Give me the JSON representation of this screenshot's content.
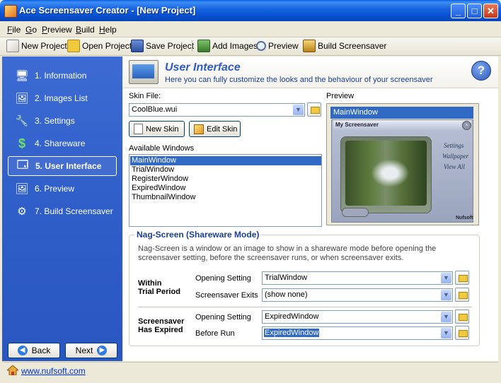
{
  "window": {
    "title": "Ace Screensaver Creator - [New Project]"
  },
  "menu": [
    "File",
    "Go",
    "Preview",
    "Build",
    "Help"
  ],
  "toolbar": {
    "new_project": "New Project",
    "open_project": "Open Project",
    "save_project": "Save Project",
    "add_images": "Add Images",
    "preview": "Preview",
    "build_screensaver": "Build Screensaver"
  },
  "sidebar": {
    "items": [
      {
        "label": "1. Information",
        "icon": "info-icon"
      },
      {
        "label": "2. Images List",
        "icon": "images-icon"
      },
      {
        "label": "3. Settings",
        "icon": "tools-icon"
      },
      {
        "label": "4. Shareware",
        "icon": "dollar-icon"
      },
      {
        "label": "5. User Interface",
        "icon": "ui-icon"
      },
      {
        "label": "6. Preview",
        "icon": "preview-icon"
      },
      {
        "label": "7. Build Screensaver",
        "icon": "build-icon"
      }
    ],
    "active": "5. User Interface",
    "back_label": "Back",
    "next_label": "Next"
  },
  "header": {
    "title": "User Interface",
    "subtitle": "Here you can fully customize the looks and the behaviour of your screensaver"
  },
  "skin": {
    "label": "Skin File:",
    "value": "CoolBlue.wui",
    "new_skin": "New Skin",
    "edit_skin": "Edit Skin"
  },
  "available_windows": {
    "label": "Available Windows",
    "items": [
      "MainWindow",
      "TrialWindow",
      "RegisterWindow",
      "ExpiredWindow",
      "ThumbnailWindow"
    ],
    "selected": "MainWindow"
  },
  "preview": {
    "label": "Preview",
    "selected_window": "MainWindow",
    "window_caption": "My Screensaver",
    "menu_items": [
      "Settings",
      "Wallpaper",
      "View All"
    ],
    "brand": "Nufsoft"
  },
  "nag": {
    "title": "Nag-Screen (Shareware Mode)",
    "description": "Nag-Screen is a window or an image to show in a shareware mode before opening the screensaver setting, before the screensaver runs, or when screensaver exits.",
    "trial": {
      "label_line1": "Within",
      "label_line2": "Trial Period",
      "opening_setting_label": "Opening Setting",
      "opening_setting_value": "TrialWindow",
      "screensaver_exits_label": "Screensaver Exits",
      "screensaver_exits_value": "(show none)"
    },
    "expired": {
      "label_line1": "Screensaver",
      "label_line2": "Has Expired",
      "opening_setting_label": "Opening Setting",
      "opening_setting_value": "ExpiredWindow",
      "before_run_label": "Before Run",
      "before_run_value": "ExpiredWindow"
    }
  },
  "statusbar": {
    "link": "www.nufsoft.com"
  }
}
